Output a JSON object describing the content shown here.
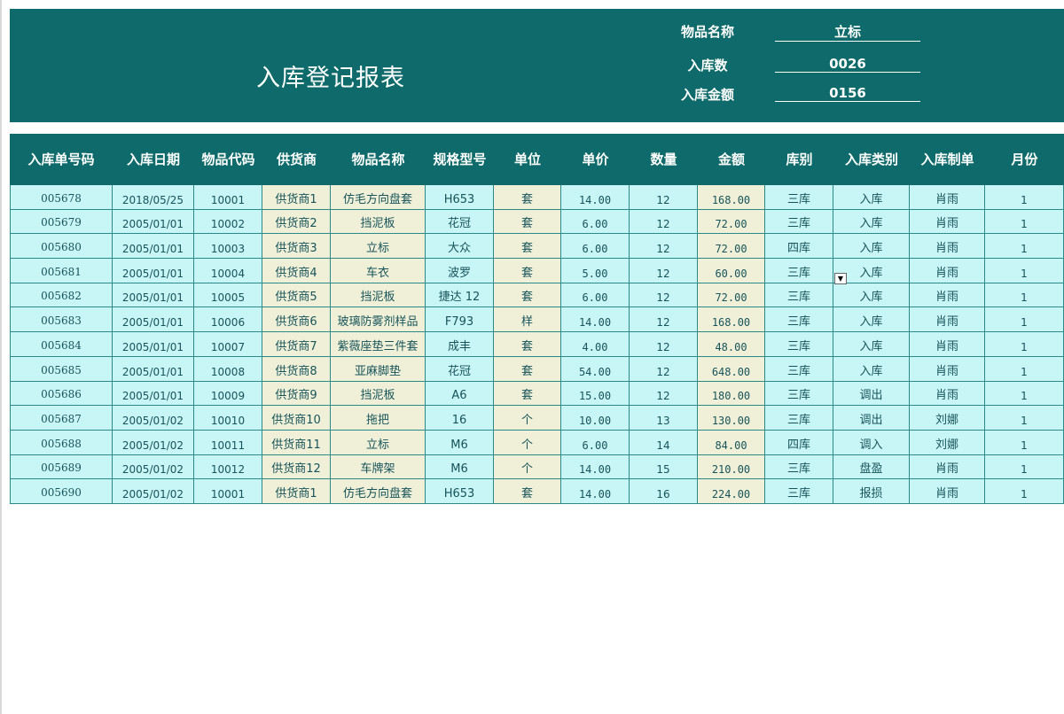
{
  "report": {
    "title": "入库登记报表",
    "item_name_label": "物品名称",
    "item_name_value": "立标",
    "in_qty_label": "入库数",
    "in_qty_value": "0026",
    "in_amount_label": "入库金额",
    "in_amount_value": "0156"
  },
  "colors": {
    "header_bg": "#0f6b6b",
    "cyan_cell": "#c8f5f5",
    "beige_cell": "#f0f0d8",
    "grid": "#2a8a8a"
  },
  "table": {
    "headers": [
      "入库单号码",
      "入库日期",
      "物品代码",
      "供货商",
      "物品名称",
      "规格型号",
      "单位",
      "单价",
      "数量",
      "金额",
      "库别",
      "入库类别",
      "入库制单",
      "月份"
    ],
    "rows": [
      [
        "005678",
        "2018/05/25",
        "10001",
        "供货商1",
        "仿毛方向盘套",
        "H653",
        "套",
        "14.00",
        "12",
        "168.00",
        "三库",
        "入库",
        "肖雨",
        "1"
      ],
      [
        "005679",
        "2005/01/01",
        "10002",
        "供货商2",
        "挡泥板",
        "花冠",
        "套",
        "6.00",
        "12",
        "72.00",
        "三库",
        "入库",
        "肖雨",
        "1"
      ],
      [
        "005680",
        "2005/01/01",
        "10003",
        "供货商3",
        "立标",
        "大众",
        "套",
        "6.00",
        "12",
        "72.00",
        "四库",
        "入库",
        "肖雨",
        "1"
      ],
      [
        "005681",
        "2005/01/01",
        "10004",
        "供货商4",
        "车衣",
        "波罗",
        "套",
        "5.00",
        "12",
        "60.00",
        "三库",
        "入库",
        "肖雨",
        "1"
      ],
      [
        "005682",
        "2005/01/01",
        "10005",
        "供货商5",
        "挡泥板",
        "捷达 12",
        "套",
        "6.00",
        "12",
        "72.00",
        "三库",
        "入库",
        "肖雨",
        "1"
      ],
      [
        "005683",
        "2005/01/01",
        "10006",
        "供货商6",
        "玻璃防雾剂样品",
        "F793",
        "样",
        "14.00",
        "12",
        "168.00",
        "三库",
        "入库",
        "肖雨",
        "1"
      ],
      [
        "005684",
        "2005/01/01",
        "10007",
        "供货商7",
        "紫薇座垫三件套",
        "成丰",
        "套",
        "4.00",
        "12",
        "48.00",
        "三库",
        "入库",
        "肖雨",
        "1"
      ],
      [
        "005685",
        "2005/01/01",
        "10008",
        "供货商8",
        "亚麻脚垫",
        "花冠",
        "套",
        "54.00",
        "12",
        "648.00",
        "三库",
        "入库",
        "肖雨",
        "1"
      ],
      [
        "005686",
        "2005/01/01",
        "10009",
        "供货商9",
        "挡泥板",
        "A6",
        "套",
        "15.00",
        "12",
        "180.00",
        "三库",
        "调出",
        "肖雨",
        "1"
      ],
      [
        "005687",
        "2005/01/02",
        "10010",
        "供货商10",
        "拖把",
        "16",
        "个",
        "10.00",
        "13",
        "130.00",
        "三库",
        "调出",
        "刘娜",
        "1"
      ],
      [
        "005688",
        "2005/01/02",
        "10011",
        "供货商11",
        "立标",
        "M6",
        "个",
        "6.00",
        "14",
        "84.00",
        "四库",
        "调入",
        "刘娜",
        "1"
      ],
      [
        "005689",
        "2005/01/02",
        "10012",
        "供货商12",
        "车牌架",
        "M6",
        "个",
        "14.00",
        "15",
        "210.00",
        "三库",
        "盘盈",
        "肖雨",
        "1"
      ],
      [
        "005690",
        "2005/01/02",
        "10001",
        "供货商1",
        "仿毛方向盘套",
        "H653",
        "套",
        "14.00",
        "16",
        "224.00",
        "三库",
        "报损",
        "肖雨",
        "1"
      ]
    ]
  }
}
